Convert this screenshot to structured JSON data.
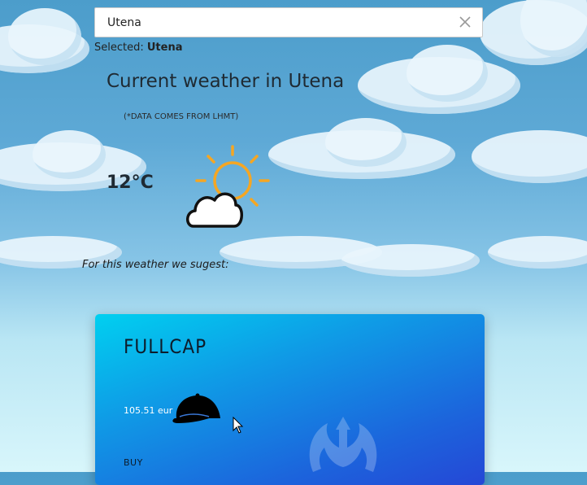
{
  "search": {
    "value": "Utena"
  },
  "selected": {
    "prefix": "Selected:",
    "city": "Utena"
  },
  "weather": {
    "title": "Current weather in Utena",
    "source": "(*DATA COMES FROM LHMT)",
    "temperature": "12°C",
    "condition_icon": "partly-cloudy-icon"
  },
  "suggestion": {
    "label": "For this weather we sugest:"
  },
  "product": {
    "name": "FULLCAP",
    "price": "105.51 eur",
    "icon": "cap-icon",
    "buy_label": "BUY",
    "emblem_icon": "rebel-alliance-icon"
  },
  "colors": {
    "sun": "#f5a623",
    "card_start": "#00d0f0",
    "card_end": "#2547d6"
  }
}
